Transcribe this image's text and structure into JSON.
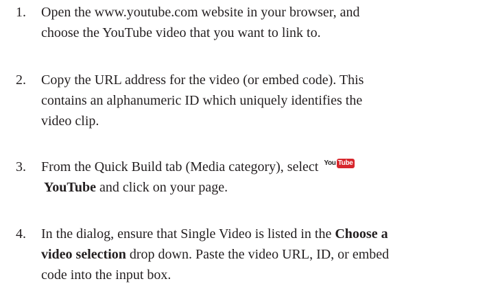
{
  "steps": [
    {
      "number": "1.",
      "lines": [
        "Open the www.youtube.com website in your browser, and",
        "choose the YouTube video that you want to link to."
      ]
    },
    {
      "number": "2.",
      "lines": [
        "Copy the URL address for the video (or embed code). This",
        "contains an alphanumeric ID which uniquely identifies the",
        "video clip."
      ]
    },
    {
      "number": "3.",
      "line1": "From the Quick Build tab (Media category), select",
      "icon": {
        "name": "youtube-logo-icon",
        "part1": "You",
        "part2": "Tube"
      },
      "line2_bold": "YouTube",
      "line2_rest": " and click on your page."
    },
    {
      "number": "4.",
      "line1_start": "In the dialog, ensure that Single Video is listed in the ",
      "line1_bold": "Choose a",
      "line2_bold": "video selection",
      "line2_rest": " drop down. Paste the video URL, ID, or embed",
      "line3": "code into the input box."
    }
  ],
  "colors": {
    "text": "#231f20",
    "youtube_red": "#d7262c"
  }
}
